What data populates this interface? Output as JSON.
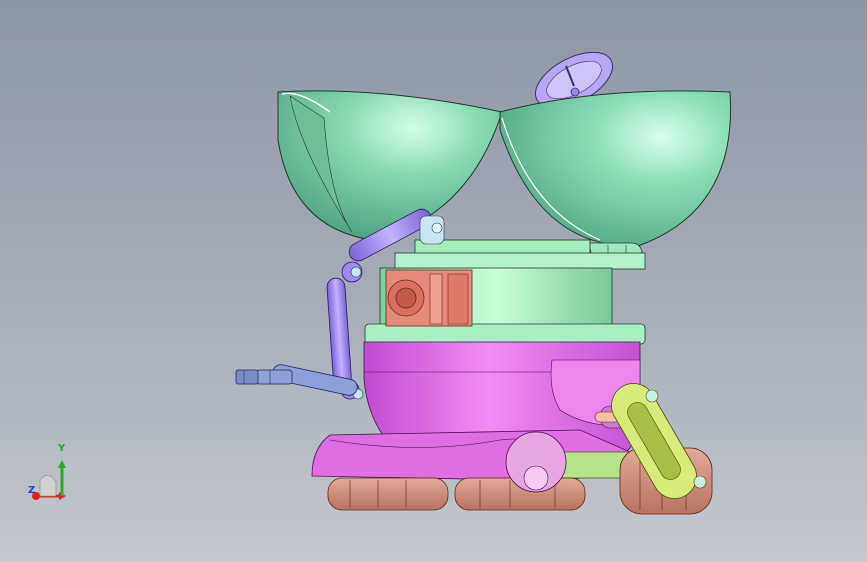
{
  "viewport": {
    "background_top": "#8e97a6",
    "background_bottom": "#c4c8cf"
  },
  "model": {
    "colors": {
      "dome": "#8ee0b8",
      "dome_shadow": "#4fa583",
      "dish": "#b7a6f2",
      "arm": "#9f89ee",
      "body_top": "#a6eec0",
      "body_bottom": "#e374e8",
      "hull": "#e06fe3",
      "track": "#d69a86",
      "wheel": "#e8a6e3",
      "bracket": "#d8ea7a",
      "gripper": "#8fa0d8",
      "box": "#e88a7a"
    }
  },
  "triad": {
    "x_label": "X",
    "y_label": "Y",
    "z_label": "Z",
    "x_color": "#e02020",
    "y_color": "#20b020",
    "z_color": "#2040e0"
  }
}
